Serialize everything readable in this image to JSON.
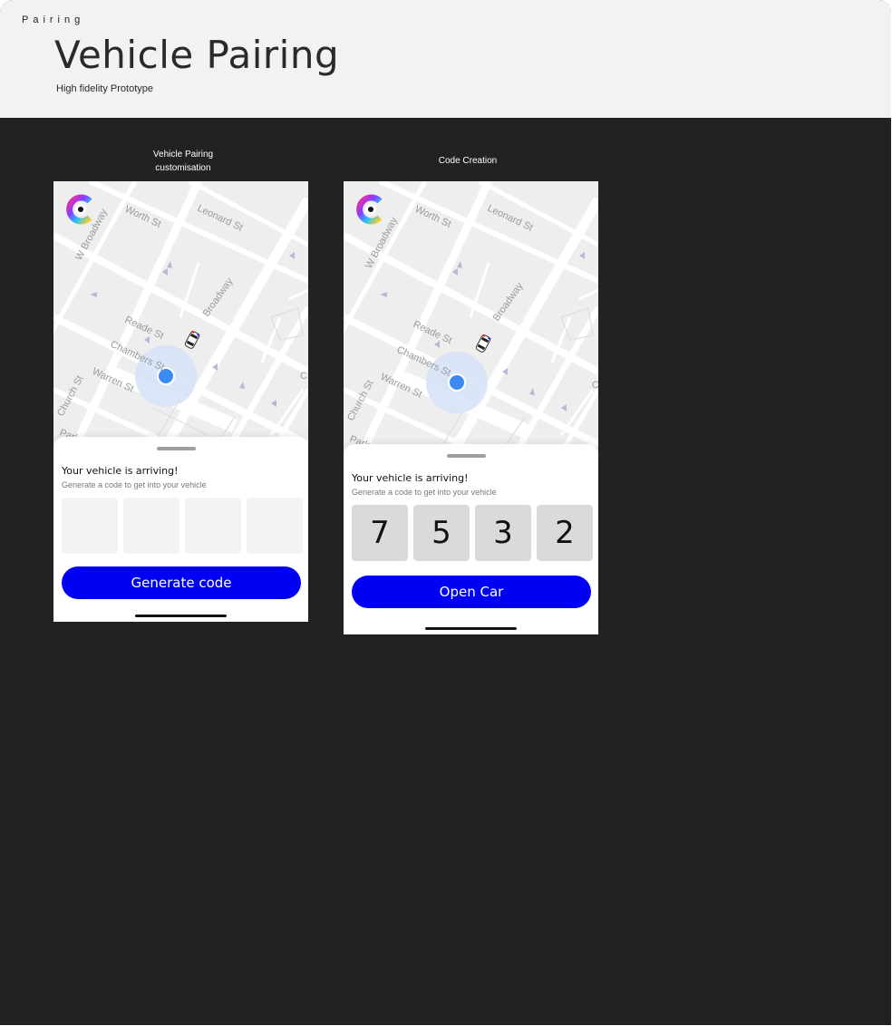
{
  "header": {
    "eyebrow": "Pairing",
    "title": "Vehicle Pairing",
    "subtitle": "High fidelity Prototype"
  },
  "frames": [
    {
      "label_line1": "Vehicle Pairing",
      "label_line2": "customisation",
      "sheet_title": "Your vehicle is arriving!",
      "sheet_subtitle": "Generate a code to get into your vehicle",
      "code_digits": [
        "",
        "",
        "",
        ""
      ],
      "button_label": "Generate code"
    },
    {
      "label_line1": "Code Creation",
      "sheet_title": "Your vehicle is arriving!",
      "sheet_subtitle": "Generate a code to get into your vehicle",
      "code_digits": [
        "7",
        "5",
        "3",
        "2"
      ],
      "button_label": "Open Car"
    }
  ],
  "map_labels": {
    "w_broadway": "W Broadway",
    "worth": "Worth St",
    "leonard": "Leonard St",
    "broadway": "Broadway",
    "reade": "Reade St",
    "chambers": "Chambers St",
    "warren": "Warren St",
    "church": "Church St",
    "park": "Park",
    "c": "C"
  },
  "icons": {
    "logo": "app-logo-icon",
    "car": "car-icon",
    "location": "location-dot-icon"
  },
  "colors": {
    "primary_button": "#0000f5",
    "location_dot": "#3d8bf2",
    "background": "#222222",
    "header_bg": "#f2f2f2"
  }
}
